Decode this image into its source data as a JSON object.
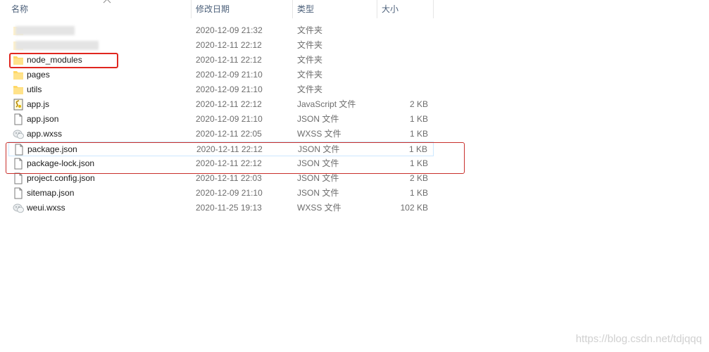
{
  "columns": {
    "name": "名称",
    "date_modified": "修改日期",
    "type": "类型",
    "size": "大小"
  },
  "files": [
    {
      "name": "",
      "date": "2020-12-09 21:32",
      "type": "文件夹",
      "size": "",
      "icon": "folder-icon"
    },
    {
      "name": "",
      "date": "2020-12-11 22:12",
      "type": "文件夹",
      "size": "",
      "icon": "folder-icon"
    },
    {
      "name": "node_modules",
      "date": "2020-12-11 22:12",
      "type": "文件夹",
      "size": "",
      "icon": "folder-icon"
    },
    {
      "name": "pages",
      "date": "2020-12-09 21:10",
      "type": "文件夹",
      "size": "",
      "icon": "folder-icon"
    },
    {
      "name": "utils",
      "date": "2020-12-09 21:10",
      "type": "文件夹",
      "size": "",
      "icon": "folder-icon"
    },
    {
      "name": "app.js",
      "date": "2020-12-11 22:12",
      "type": "JavaScript 文件",
      "size": "2 KB",
      "icon": "javascript-file-icon"
    },
    {
      "name": "app.json",
      "date": "2020-12-09 21:10",
      "type": "JSON 文件",
      "size": "1 KB",
      "icon": "file-icon"
    },
    {
      "name": "app.wxss",
      "date": "2020-12-11 22:05",
      "type": "WXSS 文件",
      "size": "1 KB",
      "icon": "wxss-file-icon"
    },
    {
      "name": "package.json",
      "date": "2020-12-11 22:12",
      "type": "JSON 文件",
      "size": "1 KB",
      "icon": "file-icon"
    },
    {
      "name": "package-lock.json",
      "date": "2020-12-11 22:12",
      "type": "JSON 文件",
      "size": "1 KB",
      "icon": "file-icon"
    },
    {
      "name": "project.config.json",
      "date": "2020-12-11 22:03",
      "type": "JSON 文件",
      "size": "2 KB",
      "icon": "file-icon"
    },
    {
      "name": "sitemap.json",
      "date": "2020-12-09 21:10",
      "type": "JSON 文件",
      "size": "1 KB",
      "icon": "file-icon"
    },
    {
      "name": "weui.wxss",
      "date": "2020-11-25 19:13",
      "type": "WXSS 文件",
      "size": "102 KB",
      "icon": "wxss-file-icon"
    }
  ],
  "watermark": "https://blog.csdn.net/tdjqqq",
  "colors": {
    "folder": "#ffd866",
    "highlight_red": "#e0261f",
    "header_text": "#4c607a",
    "meta_text": "#6d6d6d"
  }
}
